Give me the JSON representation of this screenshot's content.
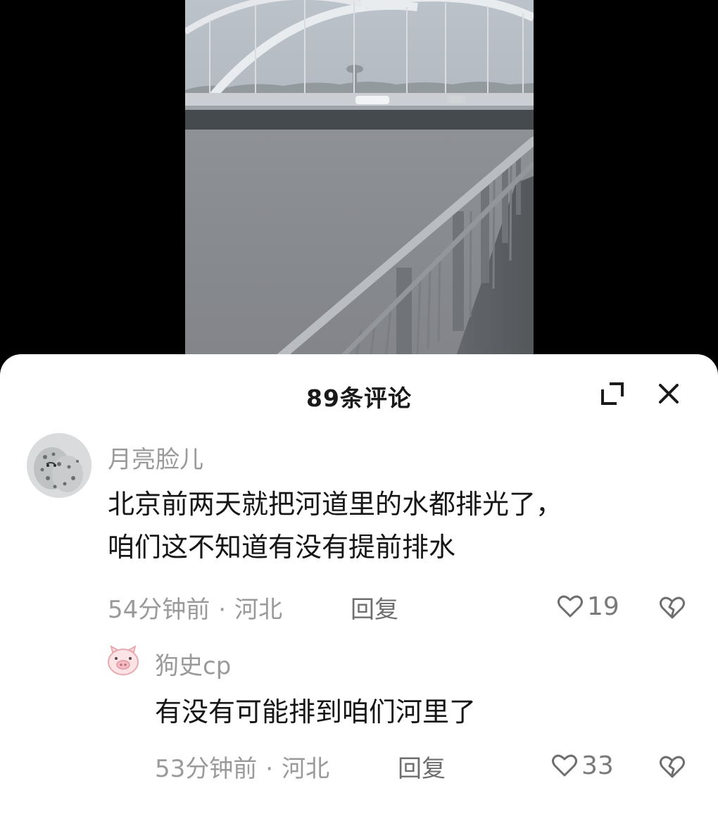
{
  "sheet": {
    "title": "89条评论",
    "expand_icon": "expand-icon",
    "close_icon": "close-icon"
  },
  "comments": [
    {
      "author": "月亮脸儿",
      "avatar": "snow-leopard-avatar",
      "lines": [
        "北京前两天就把河道里的水都排光了，",
        "咱们这不知道有没有提前排水"
      ],
      "time": "54分钟前",
      "dot": "·",
      "location": "河北",
      "reply_label": "回复",
      "likes": "19",
      "like_icon": "heart-icon",
      "dislike_icon": "broken-heart-icon"
    },
    {
      "author": "狗史cp",
      "avatar": "pig-avatar",
      "lines": [
        "有没有可能排到咱们河里了"
      ],
      "time": "53分钟前",
      "dot": "·",
      "location": "河北",
      "reply_label": "回复",
      "likes": "33",
      "like_icon": "heart-icon",
      "dislike_icon": "broken-heart-icon"
    }
  ]
}
